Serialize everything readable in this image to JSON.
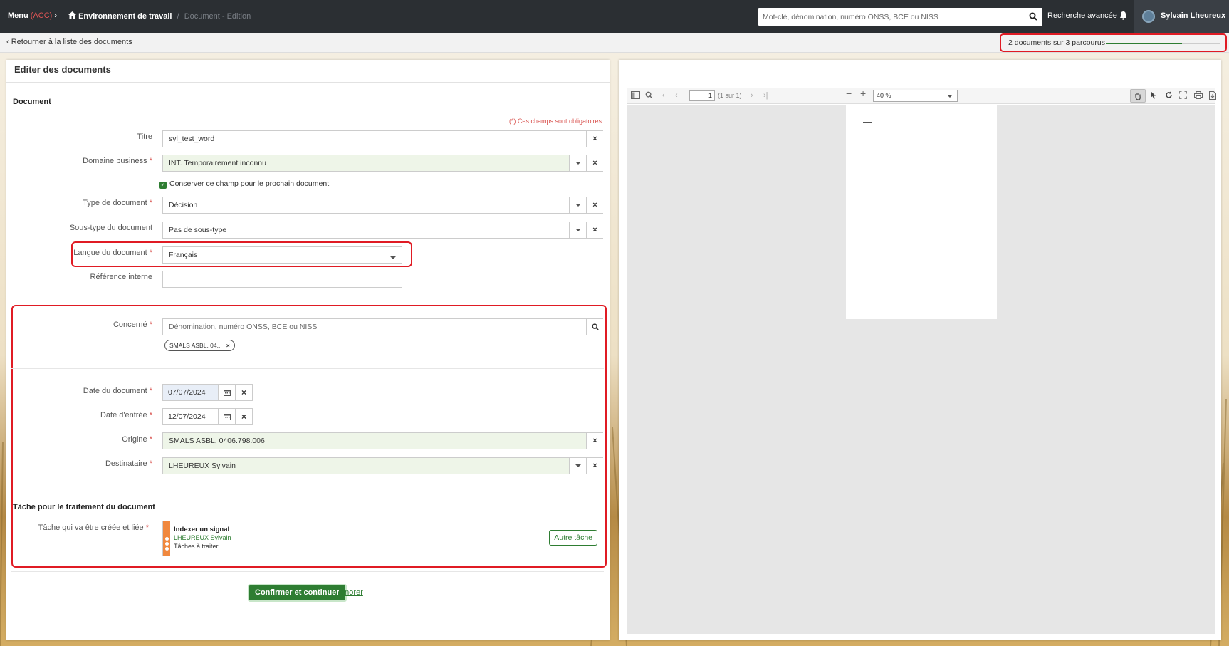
{
  "topbar": {
    "menu_label": "Menu",
    "menu_env": "(ACC)",
    "breadcrumb_home": "Environnement de travail",
    "breadcrumb_current": "Document - Edition",
    "search_placeholder": "Mot-clé, dénomination, numéro ONSS, BCE ou NISS",
    "advanced_search": "Recherche avancée",
    "user_name": "Sylvain Lheureux"
  },
  "subbar": {
    "back_label": "Retourner à la liste des documents",
    "progress_text": "2 documents sur 3 parcourus",
    "progress_fraction": 0.67
  },
  "form": {
    "panel_title": "Editer des documents",
    "section_document": "Document",
    "required_note": "(*) Ces champs sont obligatoires",
    "titre_label": "Titre",
    "titre_value": "syl_test_word",
    "domaine_label": "Domaine business",
    "domaine_value": "INT. Temporairement inconnu",
    "keep_field_label": "Conserver ce champ pour le prochain document",
    "type_label": "Type de document",
    "type_value": "Décision",
    "soustype_label": "Sous-type du document",
    "soustype_value": "Pas de sous-type",
    "langue_label": "Langue du document",
    "langue_value": "Français",
    "reference_label": "Référence interne",
    "reference_value": "",
    "concerne_label": "Concerné",
    "concerne_placeholder": "Dénomination, numéro ONSS, BCE ou NISS",
    "concerne_tag": "SMALS ASBL, 04...",
    "date_doc_label": "Date du document",
    "date_doc_value": "07/07/2024",
    "date_entree_label": "Date d'entrée",
    "date_entree_value": "12/07/2024",
    "origine_label": "Origine",
    "origine_value": "SMALS ASBL, 0406.798.006",
    "destinataire_label": "Destinataire",
    "destinataire_value": "LHEUREUX Sylvain",
    "section_task": "Tâche pour le traitement du document",
    "task_label": "Tâche qui va être créée et liée",
    "task_title": "Indexer un signal",
    "task_user": "LHEUREUX Sylvain",
    "task_queue": "Tâches à traiter",
    "other_task_button": "Autre tâche",
    "confirm_button": "Confirmer et continuer",
    "ignore_link": "Ignorer",
    "star": "*"
  },
  "viewer": {
    "page_number": "1",
    "page_of": "(1 sur 1)",
    "zoom": "40 %"
  },
  "colors": {
    "accent_green": "#2e7d32",
    "highlight_red": "#e01b24",
    "topbar": "#2b2f33"
  }
}
